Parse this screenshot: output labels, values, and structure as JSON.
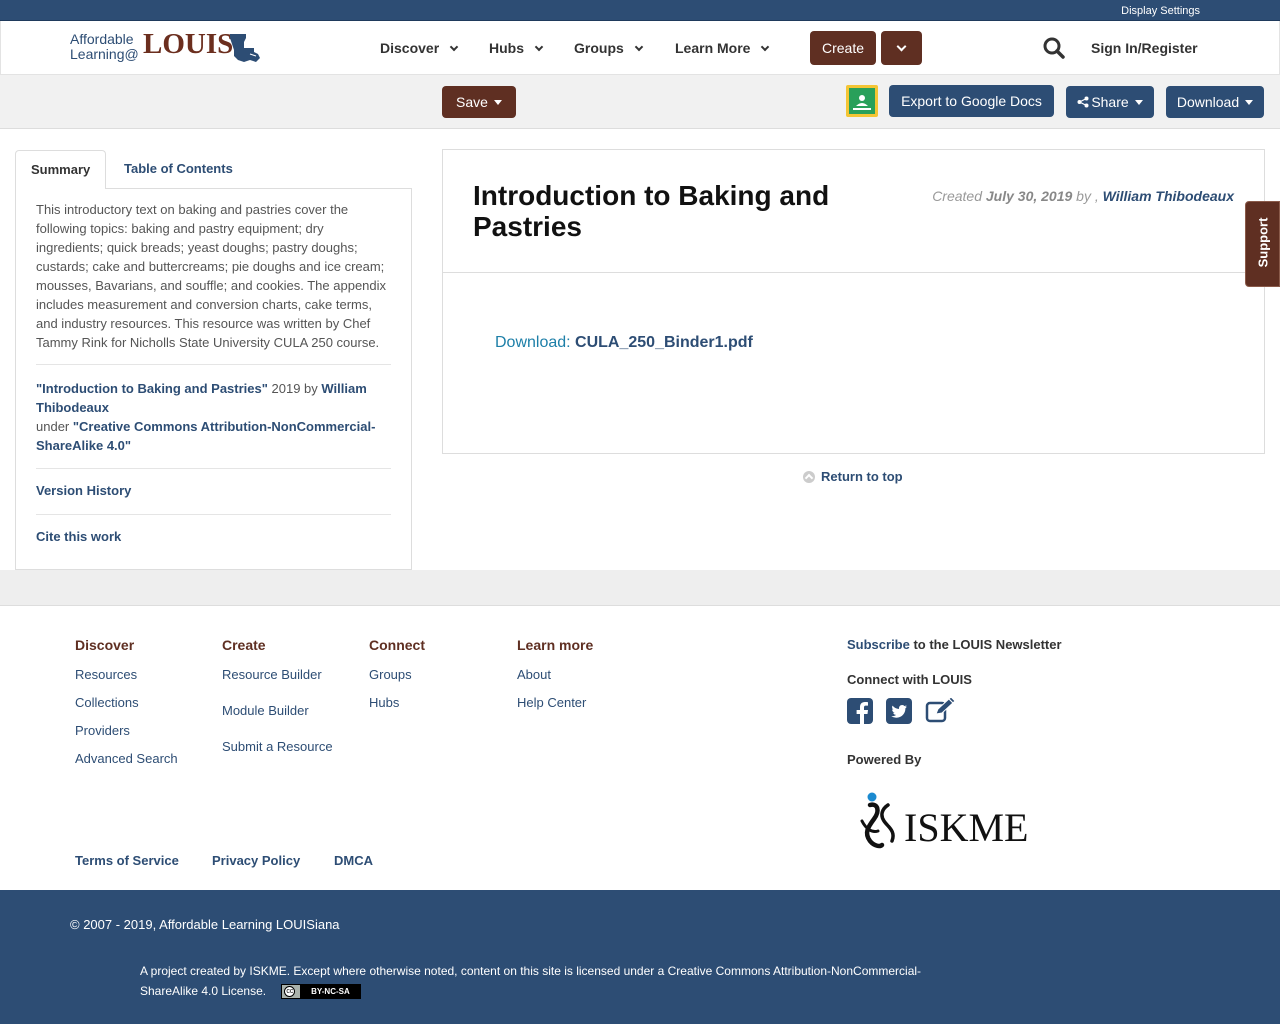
{
  "topbar": {
    "display_settings": "Display Settings"
  },
  "logo": {
    "line1": "Affordable",
    "line2": "Learning@",
    "brand": "LOUIS"
  },
  "nav": {
    "items": [
      {
        "label": "Discover"
      },
      {
        "label": "Hubs"
      },
      {
        "label": "Groups"
      },
      {
        "label": "Learn More"
      }
    ],
    "create_label": "Create",
    "signin_label": "Sign In/Register"
  },
  "toolbar": {
    "save_label": "Save",
    "export_label": "Export to Google Docs",
    "share_label": "Share",
    "download_label": "Download"
  },
  "tabs": {
    "summary": "Summary",
    "toc": "Table of Contents"
  },
  "left_panel": {
    "summary": "This introductory text on baking and pastries cover the following topics: baking and pastry equipment; dry ingredients; quick breads; yeast doughs; pastry doughs; custards; cake and buttercreams; pie doughs and ice cream; mousses, Bavarians, and souffle; and cookies. The appendix includes measurement and conversion charts, cake terms, and industry resources. This resource was written by Chef Tammy Rink for Nicholls State University CULA 250 course.",
    "attrib_title": "\"Introduction to Baking and Pastries\"",
    "attrib_year": " 2019 by ",
    "attrib_author": "William Thibodeaux",
    "attrib_under": "under ",
    "attrib_license": "\"Creative Commons Attribution-NonCommercial-ShareAlike 4.0\"",
    "version_history": "Version History",
    "cite": "Cite this work"
  },
  "main": {
    "title": "Introduction to Baking and Pastries",
    "created_prefix": "Created ",
    "created_date": "July 30, 2019",
    "created_by": " by , ",
    "author": "William Thibodeaux",
    "download_label": "Download: ",
    "file_name": "CULA_250_Binder1.pdf",
    "return_top": "Return to top"
  },
  "support_label": "Support",
  "footer": {
    "columns": [
      {
        "heading": "Discover",
        "links": [
          "Resources",
          "Collections",
          "Providers",
          "Advanced Search"
        ]
      },
      {
        "heading": "Create",
        "links": [
          "Resource Builder",
          "Module Builder",
          "Submit a Resource"
        ]
      },
      {
        "heading": "Connect",
        "links": [
          "Groups",
          "Hubs"
        ]
      },
      {
        "heading": "Learn more",
        "links": [
          "About",
          "Help Center"
        ]
      }
    ],
    "legal": [
      "Terms of Service",
      "Privacy Policy",
      "DMCA"
    ],
    "subscribe_link": "Subscribe",
    "subscribe_rest": " to the LOUIS Newsletter",
    "connect_label": "Connect with LOUIS",
    "powered_by": "Powered By",
    "iskme_logo": "ISKME"
  },
  "bottom": {
    "copyright": "© 2007 - 2019, Affordable Learning LOUISiana",
    "license_text": "A project created by ISKME. Except where otherwise noted, content on this site is licensed under a Creative Commons Attribution-NonCommercial-ShareAlike 4.0 License.",
    "cc_badge": "BY-NC-SA"
  },
  "colors": {
    "navy": "#2d4d74",
    "brown": "#5f2f22",
    "link_teal": "#1d7fa8"
  }
}
